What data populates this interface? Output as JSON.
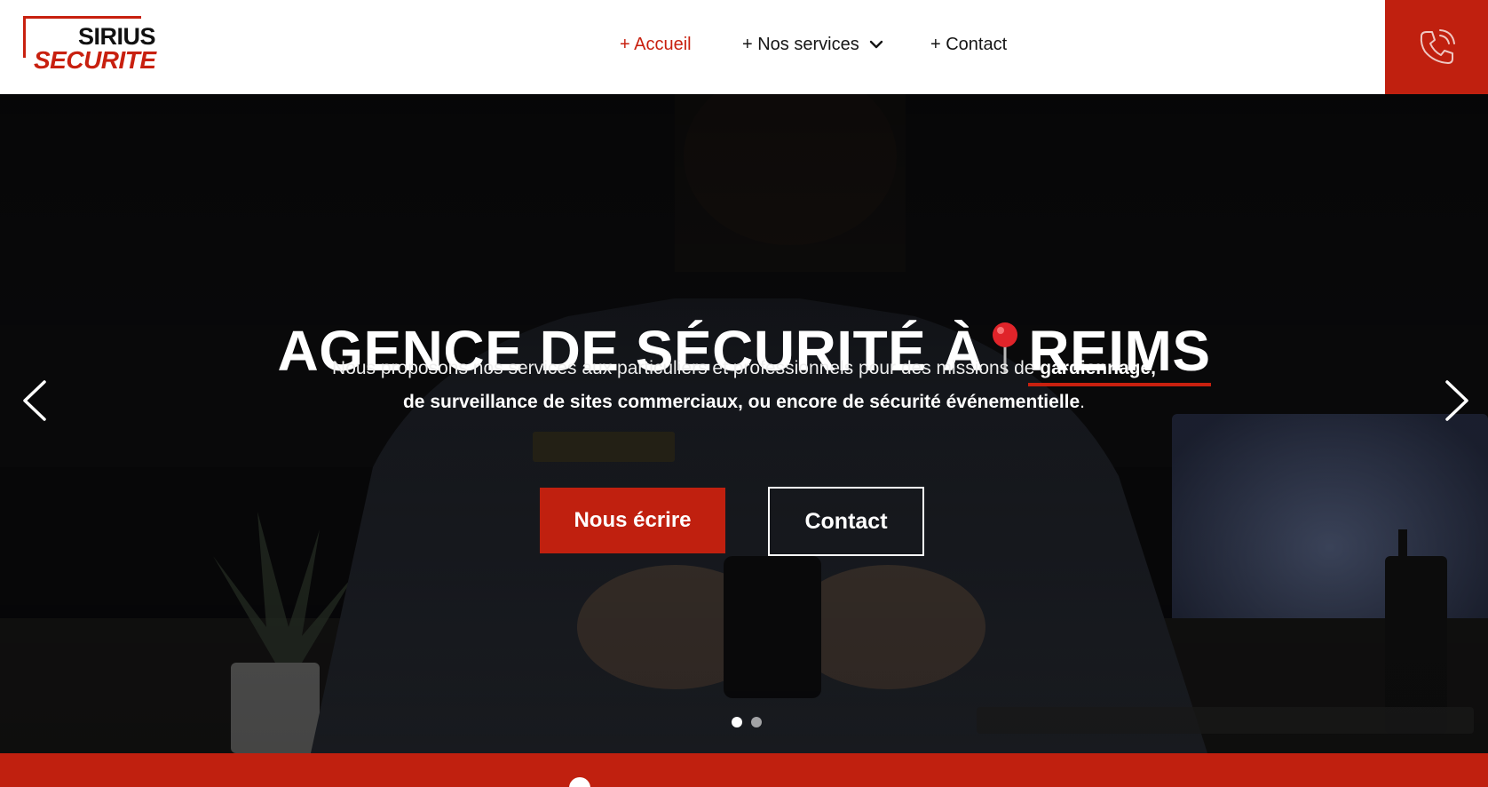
{
  "brand": {
    "line1": "SIRIUS",
    "line2": "SECURITE",
    "accent": "#c8200f"
  },
  "nav": {
    "items": [
      {
        "label": "+ Accueil",
        "active": true
      },
      {
        "label": "+ Nos services",
        "has_dropdown": true
      },
      {
        "label": "+ Contact"
      }
    ]
  },
  "header": {
    "phone_icon": "phone-icon"
  },
  "hero": {
    "title_main": "AGENCE DE SÉCURITÉ À",
    "title_city": "REIMS",
    "pin_icon": "pushpin-icon",
    "intro_1": "Nous proposons nos services aux particuliers et professionnels pour des missions de ",
    "intro_bold_1": "gardiennage,",
    "intro_bold_2": "de surveillance de sites commerciaux, ou encore de sécurité événementielle",
    "intro_end": ".",
    "cta_primary": "Nous écrire",
    "cta_secondary": "Contact",
    "slides": {
      "count": 2,
      "active": 1
    },
    "prev_icon": "chevron-left-icon",
    "next_icon": "chevron-right-icon"
  },
  "colors": {
    "primary": "#c0200f",
    "text_dark": "#151515",
    "white": "#ffffff"
  }
}
